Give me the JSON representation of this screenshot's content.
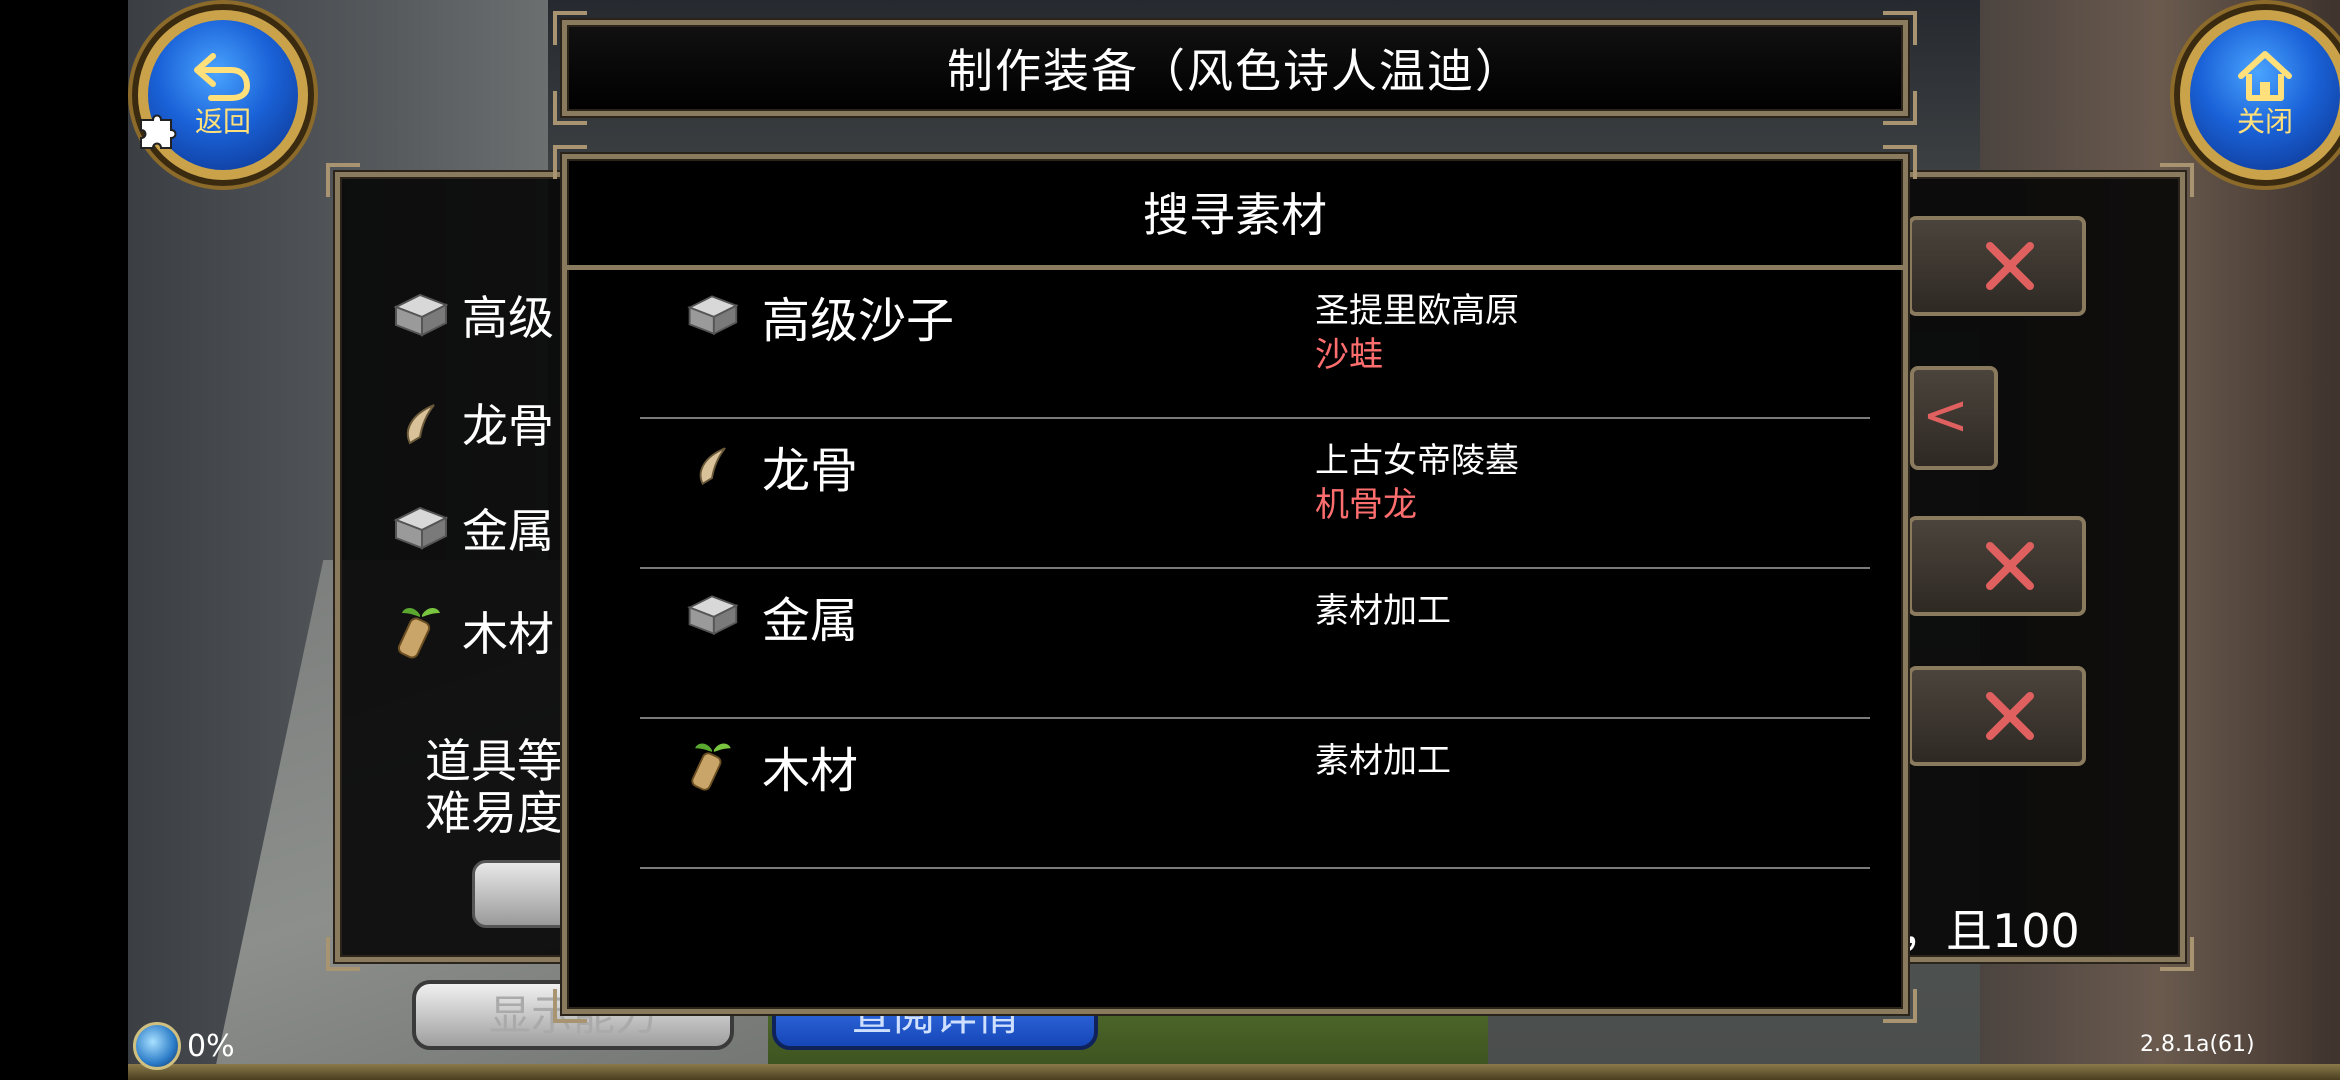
{
  "window": {
    "title": "制作装备（风色诗人温迪）",
    "back_label": "返回",
    "close_label": "关闭"
  },
  "modal": {
    "title": "搜寻素材",
    "rows": [
      {
        "icon": "silver-ingot-icon",
        "name": "高级沙子",
        "location": "圣提里欧高原",
        "monster": "沙蛙"
      },
      {
        "icon": "dragon-bone-icon",
        "name": "龙骨",
        "location": "上古女帝陵墓",
        "monster": "机骨龙"
      },
      {
        "icon": "silver-ingot-icon",
        "name": "金属",
        "location": "素材加工",
        "monster": ""
      },
      {
        "icon": "wood-log-icon",
        "name": "木材",
        "location": "素材加工",
        "monster": ""
      }
    ]
  },
  "background_panel": {
    "items": [
      {
        "icon": "silver-ingot-icon",
        "label": "高级"
      },
      {
        "icon": "dragon-bone-icon",
        "label": "龙骨"
      },
      {
        "icon": "silver-ingot-icon",
        "label": "金属"
      },
      {
        "icon": "wood-log-icon",
        "label": "木材"
      }
    ],
    "info_line1": "道具等",
    "info_line2": "难易度",
    "right_text": "，且100",
    "show_ability_button": "显示能力",
    "view_details_button": "查阅详情"
  },
  "status": {
    "progress": "0%",
    "version": "2.8.1a(61)"
  },
  "colors": {
    "frame": "#8a7a5e",
    "monster_text": "#ff6e6e",
    "x_mark": "#e06060",
    "round_button": "#1a62d8"
  }
}
